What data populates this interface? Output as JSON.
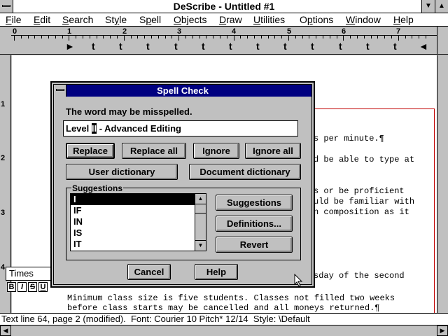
{
  "app": {
    "title": "DeScribe - Untitled #1"
  },
  "menu": [
    {
      "pre": "",
      "u": "F",
      "post": "ile"
    },
    {
      "pre": "",
      "u": "E",
      "post": "dit"
    },
    {
      "pre": "",
      "u": "S",
      "post": "earch"
    },
    {
      "pre": "St",
      "u": "y",
      "post": "le"
    },
    {
      "pre": "S",
      "u": "p",
      "post": "ell"
    },
    {
      "pre": "",
      "u": "O",
      "post": "bjects"
    },
    {
      "pre": "",
      "u": "D",
      "post": "raw"
    },
    {
      "pre": "",
      "u": "U",
      "post": "tilities"
    },
    {
      "pre": "O",
      "u": "p",
      "post": "tions"
    },
    {
      "pre": "",
      "u": "W",
      "post": "indow"
    },
    {
      "pre": "",
      "u": "H",
      "post": "elp"
    }
  ],
  "ruler": {
    "numbers": [
      "0",
      "1",
      "2",
      "3",
      "4",
      "5",
      "6",
      "7"
    ],
    "tab_symbol": "t"
  },
  "vruler": {
    "numbers": [
      "1",
      "2",
      "3",
      "4"
    ]
  },
  "document": {
    "lines": [
      "s per minute.¶",
      "d be able to type at",
      "s or be proficient",
      "uld be familiar with",
      "n composition as it",
      "sday of the second",
      "Minimum class size is five students. Classes not filled two weeks",
      "before class starts may be cancelled and all moneys returned.¶"
    ]
  },
  "toolbar": {
    "font_name": "Times",
    "format_buttons": [
      "B",
      "I",
      "S",
      "U"
    ]
  },
  "statusbar": {
    "text": "Text line 64, page 2 (modified).  Font: Courier 10 Pitch* 12/14  Style: \\Default"
  },
  "dialog": {
    "title": "Spell Check",
    "message": "The word may be misspelled.",
    "word_pre": "Level ",
    "word_sel": "II",
    "word_post": " - Advanced Editing",
    "buttons": {
      "replace": "Replace",
      "replace_all": "Replace all",
      "ignore": "Ignore",
      "ignore_all": "Ignore all",
      "user_dictionary": "User dictionary",
      "document_dictionary": "Document dictionary",
      "suggestions": "Suggestions",
      "definitions": "Definitions...",
      "revert": "Revert",
      "cancel": "Cancel",
      "help": "Help"
    },
    "suggestions_label": "Suggestions",
    "suggestions": [
      "I",
      "IF",
      "IN",
      "IS",
      "IT"
    ],
    "selected_suggestion": "I"
  }
}
